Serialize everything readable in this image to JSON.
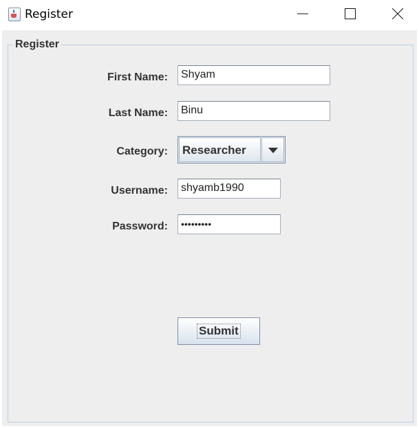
{
  "window": {
    "title": "Register",
    "icons": [
      "java-cup-icon",
      "minimize-icon",
      "maximize-icon",
      "close-icon"
    ]
  },
  "form": {
    "group_title": "Register",
    "first_name": {
      "label": "First Name:",
      "value": "Shyam"
    },
    "last_name": {
      "label": "Last Name:",
      "value": "Binu"
    },
    "category": {
      "label": "Category:",
      "selected": "Researcher"
    },
    "username": {
      "label": "Username:",
      "value": "shyamb1990"
    },
    "password": {
      "label": "Password:",
      "masked_value": "•••••••••"
    },
    "submit_label": "Submit"
  },
  "colors": {
    "panel_background": "#eeeeee",
    "group_border": "#b8cfe5",
    "label_text": "#333333"
  }
}
